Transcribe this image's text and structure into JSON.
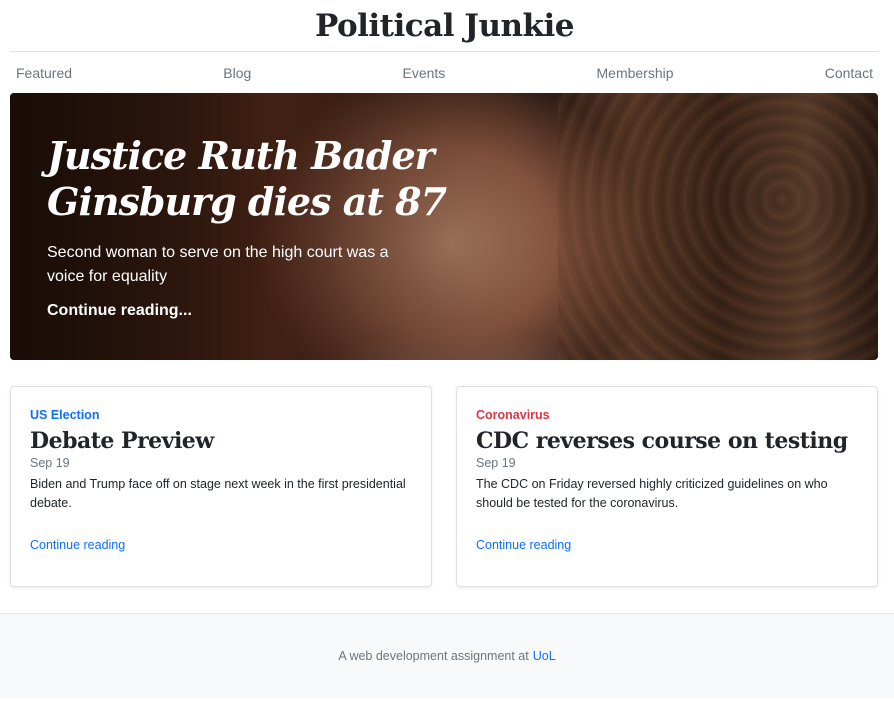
{
  "header": {
    "title": "Political Junkie"
  },
  "nav": {
    "items": [
      {
        "label": "Featured"
      },
      {
        "label": "Blog"
      },
      {
        "label": "Events"
      },
      {
        "label": "Membership"
      },
      {
        "label": "Contact"
      }
    ]
  },
  "hero": {
    "title": "Justice Ruth Bader Ginsburg dies at 87",
    "lead": "Second woman to serve on the high court was a voice for equality",
    "link": "Continue reading..."
  },
  "cards": [
    {
      "category": "US Election",
      "category_color": "#0d6efd",
      "title": "Debate Preview",
      "date": "Sep 19",
      "text": "Biden and Trump face off on stage next week in the first presidential debate.",
      "link": "Continue reading"
    },
    {
      "category": "Coronavirus",
      "category_color": "#dc3545",
      "title": "CDC reverses course on testing",
      "date": "Sep 19",
      "text": "The CDC on Friday reversed highly criticized guidelines on who should be tested for the coronavirus.",
      "link": "Continue reading"
    }
  ],
  "footer": {
    "text": "A web development assignment at",
    "link": "UoL"
  }
}
